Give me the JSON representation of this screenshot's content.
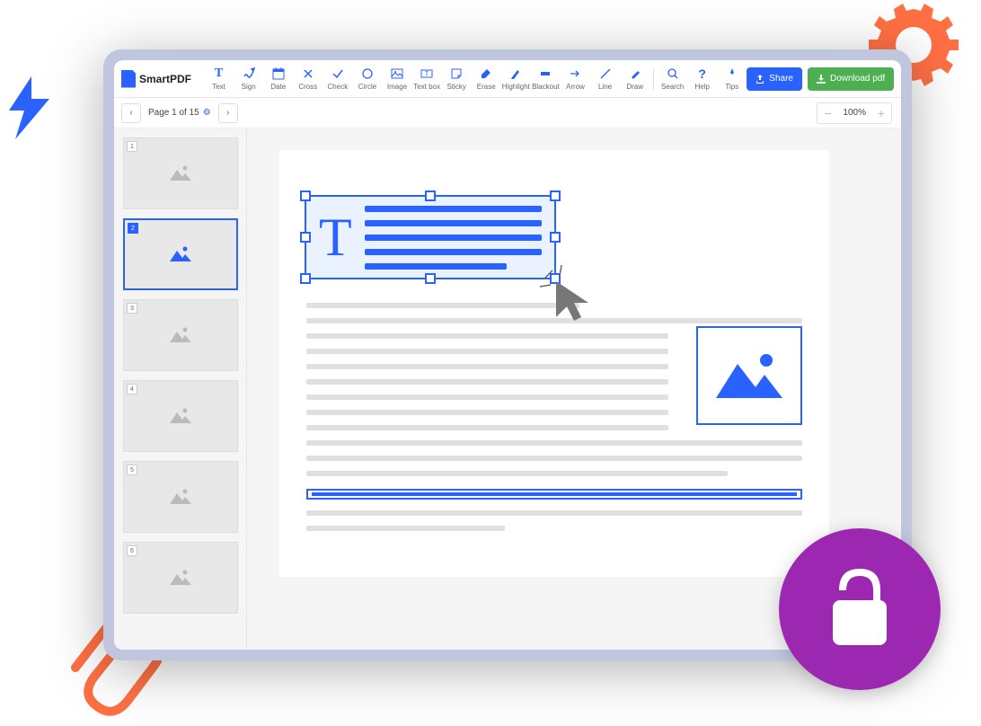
{
  "app": {
    "name": "SmartPDF"
  },
  "toolbar": {
    "tools": [
      {
        "id": "text",
        "label": "Text"
      },
      {
        "id": "sign",
        "label": "Sign"
      },
      {
        "id": "date",
        "label": "Date"
      },
      {
        "id": "cross",
        "label": "Cross"
      },
      {
        "id": "check",
        "label": "Check"
      },
      {
        "id": "circle",
        "label": "Circle"
      },
      {
        "id": "image",
        "label": "Image"
      },
      {
        "id": "textbox",
        "label": "Text box"
      },
      {
        "id": "sticky",
        "label": "Sticky"
      },
      {
        "id": "erase",
        "label": "Erase"
      },
      {
        "id": "highlight",
        "label": "Highlight"
      },
      {
        "id": "blackout",
        "label": "Blackout"
      },
      {
        "id": "arrow",
        "label": "Arrow"
      },
      {
        "id": "line",
        "label": "Line"
      },
      {
        "id": "draw",
        "label": "Draw"
      }
    ],
    "utility": [
      {
        "id": "search",
        "label": "Search"
      },
      {
        "id": "help",
        "label": "Help"
      },
      {
        "id": "tips",
        "label": "Tips"
      }
    ],
    "share": "Share",
    "download": "Download pdf"
  },
  "pagenav": {
    "label": "Page 1 of 15",
    "current": 1,
    "total": 15
  },
  "zoom": {
    "value": "100%"
  },
  "thumbnails": {
    "count": 6,
    "active_index": 2
  },
  "colors": {
    "primary": "#2962ff",
    "success": "#4caf50",
    "accent_orange": "#ff7043",
    "accent_purple": "#9C27B0"
  }
}
